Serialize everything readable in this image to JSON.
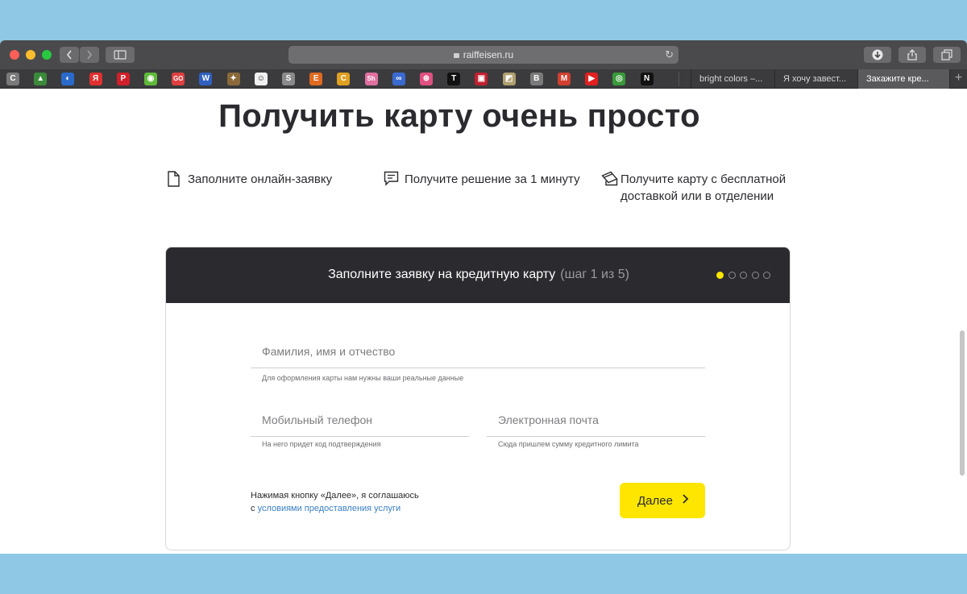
{
  "browser": {
    "url": "raiffeisen.ru",
    "tabs": [
      {
        "label": "bright colors –..."
      },
      {
        "label": "Я хочу завест..."
      },
      {
        "label": "Закажите кре..."
      }
    ],
    "favorites": [
      {
        "glyph": "C",
        "color": "#7a7a7a"
      },
      {
        "glyph": "▲",
        "color": "#3a8a3a"
      },
      {
        "glyph": "◐",
        "color": "#2a6acb"
      },
      {
        "glyph": "Я",
        "color": "#e03030"
      },
      {
        "glyph": "P",
        "color": "#d0202a"
      },
      {
        "glyph": "◉",
        "color": "#5fba3a"
      },
      {
        "glyph": "GO",
        "color": "#e04040"
      },
      {
        "glyph": "W",
        "color": "#3060c0"
      },
      {
        "glyph": "✦",
        "color": "#8a6a3a"
      },
      {
        "glyph": "☺",
        "color": "#f0f0f0"
      },
      {
        "glyph": "S",
        "color": "#8a8a8a"
      },
      {
        "glyph": "E",
        "color": "#e06a20"
      },
      {
        "glyph": "C",
        "color": "#e0a020"
      },
      {
        "glyph": "Sh",
        "color": "#e070a0"
      },
      {
        "glyph": "∞",
        "color": "#3a6ad0"
      },
      {
        "glyph": "⊛",
        "color": "#e05080"
      },
      {
        "glyph": "T",
        "color": "#111111"
      },
      {
        "glyph": "▣",
        "color": "#c02030"
      },
      {
        "glyph": "◩",
        "color": "#b0a070"
      },
      {
        "glyph": "B",
        "color": "#7a7a7a"
      },
      {
        "glyph": "M",
        "color": "#d04030"
      },
      {
        "glyph": "▶",
        "color": "#e02020"
      },
      {
        "glyph": "◎",
        "color": "#3a9a3a"
      },
      {
        "glyph": "N",
        "color": "#111111"
      }
    ]
  },
  "page": {
    "title": "Получить карту очень просто",
    "steps": [
      {
        "text": "Заполните онлайн-заявку",
        "icon": "document-icon"
      },
      {
        "text": "Получите решение за 1 минуту",
        "icon": "chat-icon"
      },
      {
        "text": "Получите карту с бесплатной доставкой или в отделении",
        "icon": "card-delivery-icon"
      }
    ]
  },
  "form": {
    "title": "Заполните заявку на кредитную карту",
    "step_text": "(шаг 1 из 5)",
    "current_step": 1,
    "total_steps": 5,
    "fields": {
      "name": {
        "placeholder": "Фамилия, имя и отчество",
        "hint": "Для оформления карты нам нужны ваши реальные данные"
      },
      "phone": {
        "placeholder": "Мобильный телефон",
        "hint": "На него придет код подтверждения"
      },
      "email": {
        "placeholder": "Электронная почта",
        "hint": "Сюда пришлем сумму кредитного лимита"
      }
    },
    "agreement_text": "Нажимая кнопку «Далее», я соглашаюсь",
    "agreement_prefix": "с",
    "agreement_link": "условиями предоставления услуги",
    "next_label": "Далее"
  },
  "colors": {
    "accent_yellow": "#fee600",
    "header_dark": "#2b2b2f",
    "link_blue": "#3a7fc4"
  }
}
